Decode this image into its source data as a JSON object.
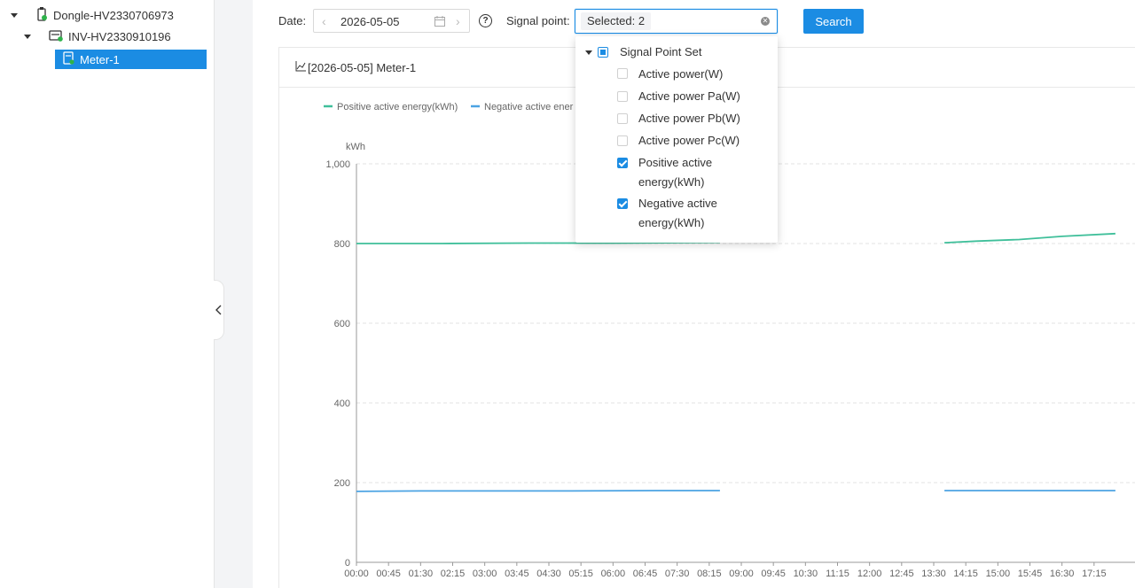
{
  "tree": {
    "items": [
      {
        "label": "Dongle-HV2330706973"
      },
      {
        "label": "INV-HV2330910196"
      },
      {
        "label": "Meter-1"
      }
    ]
  },
  "toolbar": {
    "date_label": "Date",
    "date_value": "2026-05-05",
    "signal_label": "Signal point",
    "selected_text": "Selected: 2",
    "search_label": "Search"
  },
  "dropdown": {
    "root_label": "Signal Point Set",
    "items": [
      {
        "label": "Active power(W)",
        "checked": false
      },
      {
        "label": "Active power Pa(W)",
        "checked": false
      },
      {
        "label": "Active power Pb(W)",
        "checked": false
      },
      {
        "label": "Active power Pc(W)",
        "checked": false
      },
      {
        "label_line1": "Positive active",
        "label_line2": "energy(kWh)",
        "checked": true
      },
      {
        "label_line1": "Negative active",
        "label_line2": "energy(kWh)",
        "checked": true
      }
    ]
  },
  "chart_title": "[2026-05-05] Meter-1",
  "chart_data": {
    "type": "line",
    "ylabel": "kWh",
    "ylim": [
      0,
      1000
    ],
    "y_ticks": [
      "0",
      "200",
      "400",
      "600",
      "800",
      "1,000"
    ],
    "x_tick_labels": [
      "00:00",
      "00:45",
      "01:30",
      "02:15",
      "03:00",
      "03:45",
      "04:30",
      "05:15",
      "06:00",
      "06:45",
      "07:30",
      "08:15",
      "09:00",
      "09:45",
      "10:30",
      "11:15",
      "12:00",
      "12:45",
      "13:30",
      "14:15",
      "15:00",
      "15:45",
      "16:30",
      "17:15"
    ],
    "legend": [
      "Positive active energy(kWh)",
      "Negative active ener"
    ],
    "series": [
      {
        "name": "Positive active energy(kWh)",
        "color": "#3fbf9a",
        "segments": [
          [
            [
              "00:00",
              800
            ],
            [
              "02:00",
              800
            ],
            [
              "04:00",
              801
            ],
            [
              "06:00",
              801
            ],
            [
              "07:15",
              802
            ],
            [
              "08:30",
              803
            ]
          ],
          [
            [
              "13:45",
              802
            ],
            [
              "14:30",
              806
            ],
            [
              "15:30",
              810
            ],
            [
              "16:30",
              818
            ],
            [
              "17:45",
              825
            ]
          ]
        ]
      },
      {
        "name": "Negative active ener",
        "color": "#4ba3e3",
        "segments": [
          [
            [
              "00:00",
              178
            ],
            [
              "01:30",
              179
            ],
            [
              "03:00",
              179
            ],
            [
              "05:00",
              179
            ],
            [
              "07:00",
              180
            ],
            [
              "08:30",
              180
            ]
          ],
          [
            [
              "13:45",
              180
            ],
            [
              "15:00",
              180
            ],
            [
              "16:30",
              180
            ],
            [
              "17:45",
              180
            ]
          ]
        ]
      }
    ],
    "grid": true,
    "legend_position": "top-left"
  }
}
